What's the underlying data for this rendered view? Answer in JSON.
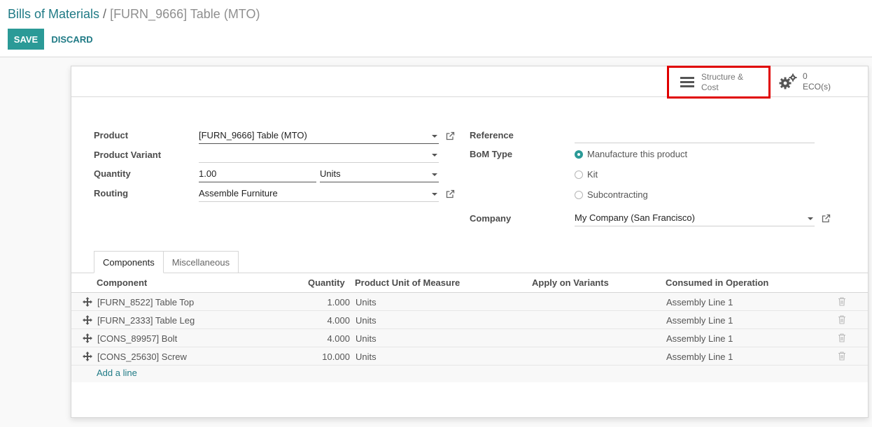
{
  "breadcrumb": {
    "parent": "Bills of Materials",
    "separator": "/",
    "current": "[FURN_9666] Table (MTO)"
  },
  "actions": {
    "save": "SAVE",
    "discard": "DISCARD"
  },
  "smart_buttons": {
    "structure": {
      "line1": "Structure &",
      "line2": "Cost"
    },
    "eco": {
      "count": "0",
      "label": "ECO(s)"
    }
  },
  "form": {
    "product": {
      "label": "Product",
      "value": "[FURN_9666] Table (MTO)"
    },
    "variant": {
      "label": "Product Variant",
      "value": ""
    },
    "quantity": {
      "label": "Quantity",
      "value": "1.00",
      "uom": "Units"
    },
    "routing": {
      "label": "Routing",
      "value": "Assemble Furniture"
    },
    "reference": {
      "label": "Reference",
      "value": ""
    },
    "bom_type": {
      "label": "BoM Type",
      "options": [
        "Manufacture this product",
        "Kit",
        "Subcontracting"
      ],
      "selected": "Manufacture this product"
    },
    "company": {
      "label": "Company",
      "value": "My Company (San Francisco)"
    }
  },
  "tabs": [
    "Components",
    "Miscellaneous"
  ],
  "active_tab": "Components",
  "grid": {
    "columns": [
      "Component",
      "Quantity",
      "Product Unit of Measure",
      "Apply on Variants",
      "Consumed in Operation"
    ],
    "rows": [
      {
        "component": "[FURN_8522] Table Top",
        "quantity": "1.000",
        "uom": "Units",
        "variants": "",
        "operation": "Assembly Line 1"
      },
      {
        "component": "[FURN_2333] Table Leg",
        "quantity": "4.000",
        "uom": "Units",
        "variants": "",
        "operation": "Assembly Line 1"
      },
      {
        "component": "[CONS_89957] Bolt",
        "quantity": "4.000",
        "uom": "Units",
        "variants": "",
        "operation": "Assembly Line 1"
      },
      {
        "component": "[CONS_25630] Screw",
        "quantity": "10.000",
        "uom": "Units",
        "variants": "",
        "operation": "Assembly Line 1"
      }
    ],
    "add_line": "Add a line"
  },
  "icons": {
    "structure": "bars-icon",
    "eco": "gears-icon",
    "external": "external-link-icon",
    "drag": "drag-handle-icon",
    "delete": "trash-icon",
    "dropdown": "caret-down-icon"
  },
  "colors": {
    "primary": "#2b9a97",
    "link": "#1f7a85",
    "highlight": "#e00000"
  }
}
